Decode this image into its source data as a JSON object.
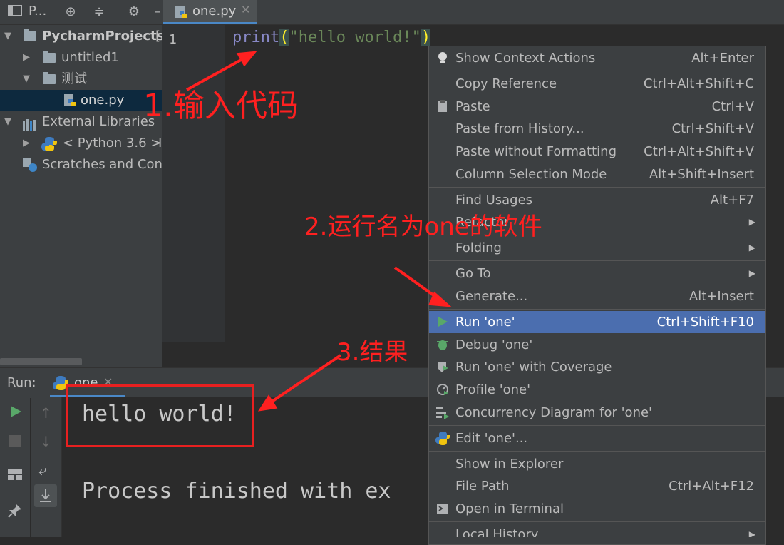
{
  "project": {
    "toolbar_title": "P...",
    "tree": [
      {
        "label": "PycharmProjects",
        "suffix": "[",
        "level": 0,
        "expanded": true
      },
      {
        "label": "untitled1",
        "level": 1,
        "expanded": false
      },
      {
        "label": "测试",
        "level": 1,
        "expanded": true
      },
      {
        "label": "one.py",
        "level": 2,
        "selected": true
      },
      {
        "label": "External Libraries",
        "level": 0,
        "expanded": true
      },
      {
        "label": "< Python 3.6 >",
        "suffix": "I",
        "level": 1,
        "expanded": false
      },
      {
        "label": "Scratches and Cons",
        "level": 0
      }
    ]
  },
  "editor": {
    "tab": "one.py",
    "line_number": "1",
    "code": {
      "fn": "print",
      "open": "(",
      "str": "\"hello world!\"",
      "close": ")"
    }
  },
  "run": {
    "label": "Run:",
    "tab": "one",
    "output": [
      "hello world!",
      "Process finished with ex"
    ]
  },
  "menu": {
    "items": [
      {
        "label": "Show Context Actions",
        "shortcut": "Alt+Enter",
        "icon": "bulb-icon"
      },
      {
        "sep": true
      },
      {
        "label": "Copy Reference",
        "shortcut": "Ctrl+Alt+Shift+C"
      },
      {
        "label": "Paste",
        "shortcut": "Ctrl+V",
        "icon": "clipboard-icon"
      },
      {
        "label": "Paste from History...",
        "shortcut": "Ctrl+Shift+V"
      },
      {
        "label": "Paste without Formatting",
        "shortcut": "Ctrl+Alt+Shift+V"
      },
      {
        "label": "Column Selection Mode",
        "shortcut": "Alt+Shift+Insert"
      },
      {
        "sep": true
      },
      {
        "label": "Find Usages",
        "shortcut": "Alt+F7"
      },
      {
        "label": "Refactor",
        "submenu": true
      },
      {
        "sep": true
      },
      {
        "label": "Folding",
        "submenu": true
      },
      {
        "sep": true
      },
      {
        "label": "Go To",
        "submenu": true
      },
      {
        "label": "Generate...",
        "shortcut": "Alt+Insert"
      },
      {
        "sep": true
      },
      {
        "label": "Run 'one'",
        "shortcut": "Ctrl+Shift+F10",
        "icon": "run-icon",
        "selected": true
      },
      {
        "label": "Debug 'one'",
        "icon": "debug-icon"
      },
      {
        "label": "Run 'one' with Coverage",
        "icon": "coverage-icon"
      },
      {
        "label": "Profile 'one'",
        "icon": "profile-icon"
      },
      {
        "label": "Concurrency Diagram for 'one'",
        "icon": "concurrency-icon"
      },
      {
        "sep": true
      },
      {
        "label": "Edit 'one'...",
        "icon": "python-icon"
      },
      {
        "sep": true
      },
      {
        "label": "Show in Explorer"
      },
      {
        "label": "File Path",
        "shortcut": "Ctrl+Alt+F12"
      },
      {
        "label": "Open in Terminal",
        "icon": "terminal-icon"
      },
      {
        "sep": true
      },
      {
        "label": "Local History",
        "submenu": true
      }
    ]
  },
  "annotations": {
    "step1": "1.输入代码",
    "step2": "2.运行名为one的软件",
    "step3": "3.结果"
  },
  "colors": {
    "accent": "#4b6eaf",
    "annotation": "#ff2020",
    "string": "#6a8759",
    "keyword": "#8888c6"
  }
}
